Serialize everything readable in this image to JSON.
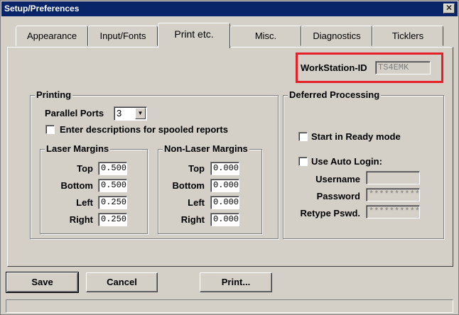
{
  "window": {
    "title": "Setup/Preferences"
  },
  "icons": {
    "close": "✕"
  },
  "tabs": [
    {
      "label": "Appearance"
    },
    {
      "label": "Input/Fonts"
    },
    {
      "label": "Print etc."
    },
    {
      "label": "Misc."
    },
    {
      "label": "Diagnostics"
    },
    {
      "label": "Ticklers"
    }
  ],
  "workstation": {
    "label": "WorkStation-ID",
    "value": "TS4EMK"
  },
  "printing": {
    "title": "Printing",
    "parallel_ports_label": "Parallel Ports",
    "parallel_ports_value": "3",
    "spool_desc_label": "Enter descriptions for spooled reports",
    "laser": {
      "title": "Laser Margins",
      "top_label": "Top",
      "top": "0.500",
      "bottom_label": "Bottom",
      "bottom": "0.500",
      "left_label": "Left",
      "left": "0.250",
      "right_label": "Right",
      "right": "0.250"
    },
    "nonlaser": {
      "title": "Non-Laser Margins",
      "top_label": "Top",
      "top": "0.000",
      "bottom_label": "Bottom",
      "bottom": "0.000",
      "left_label": "Left",
      "left": "0.000",
      "right_label": "Right",
      "right": "0.000"
    }
  },
  "deferred": {
    "title": "Deferred Processing",
    "ready_mode_label": "Start in Ready mode",
    "auto_login_label": "Use Auto Login:",
    "username_label": "Username",
    "username": "",
    "password_label": "Password",
    "password": "**********",
    "retype_label": "Retype Pswd.",
    "retype": "**********"
  },
  "buttons": {
    "save": "Save",
    "cancel": "Cancel",
    "print": "Print..."
  },
  "highlight_color": "#e32126"
}
